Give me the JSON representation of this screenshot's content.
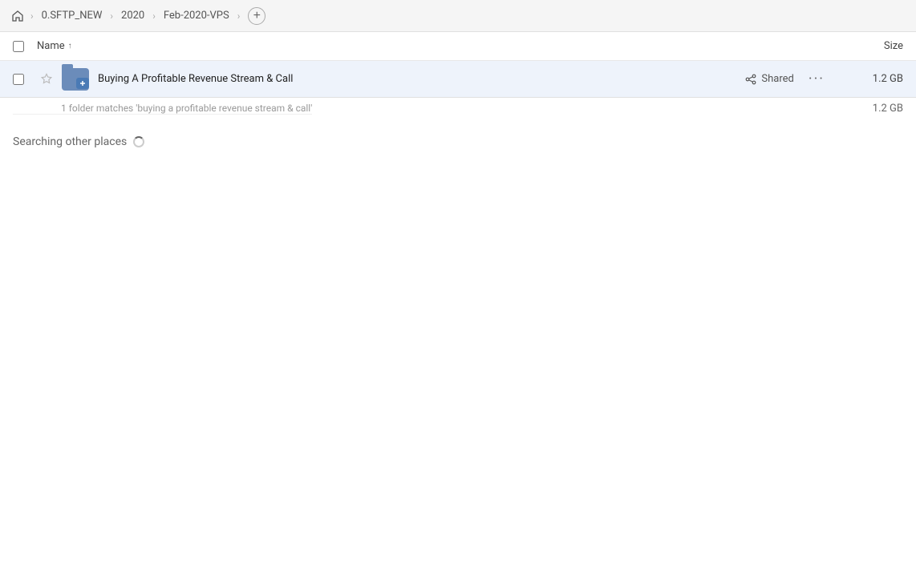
{
  "toolbar": {
    "home_label": "Home",
    "breadcrumb": [
      {
        "label": "0.SFTP_NEW"
      },
      {
        "label": "2020"
      },
      {
        "label": "Feb-2020-VPS"
      }
    ],
    "add_label": "+"
  },
  "table": {
    "col_name_label": "Name",
    "col_name_sort": "↑",
    "col_size_label": "Size"
  },
  "file_row": {
    "name": "Buying A Profitable Revenue Stream & Call",
    "shared_label": "Shared",
    "size": "1.2 GB",
    "match_text": "1 folder matches 'buying a profitable revenue stream & call'",
    "match_size": "1.2 GB"
  },
  "searching": {
    "label": "Searching other places"
  }
}
